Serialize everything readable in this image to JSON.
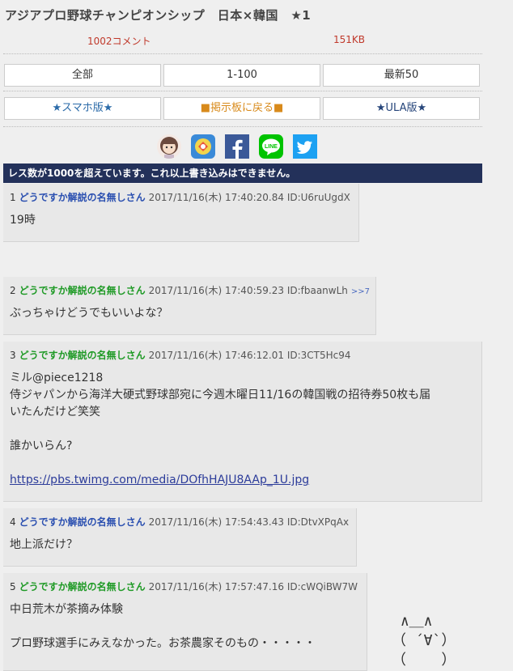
{
  "thread": {
    "title": "アジアプロ野球チャンピオンシップ　日本×韓国　★1",
    "comments": "1002コメント",
    "size": "151KB"
  },
  "nav": {
    "all": "全部",
    "range": "1-100",
    "latest": "最新50",
    "mobile": "★スマホ版★",
    "board": "■掲示板に戻る■",
    "ula": "★ULA版★"
  },
  "notice": "レス数が1000を超えています。これ以上書き込みはできません。",
  "posts": [
    {
      "num": "1",
      "name": "どうですか解説の名無しさん",
      "date": "2017/11/16(木) 17:40:20.84",
      "id": "ID:U6ruUgdX",
      "ref": "",
      "body": [
        "19時"
      ]
    },
    {
      "num": "2",
      "name": "どうですか解説の名無しさん",
      "date": "2017/11/16(木) 17:40:59.23",
      "id": "ID:fbaanwLh",
      "ref": ">>7",
      "body": [
        "ぶっちゃけどうでもいいよな？"
      ]
    },
    {
      "num": "3",
      "name": "どうですか解説の名無しさん",
      "date": "2017/11/16(木) 17:46:12.01",
      "id": "ID:3CT5Hc94",
      "ref": "",
      "body": [
        "ミル@piece1218",
        "侍ジャパンから海洋大硬式野球部宛に今週木曜日11/16の韓国戦の招待券50枚も届",
        "いたんだけど笑笑",
        "",
        "誰かいらん?",
        ""
      ],
      "link": "https://pbs.twimg.com/media/DOfhHAJU8AAp_1U.jpg"
    },
    {
      "num": "4",
      "name": "どうですか解説の名無しさん",
      "date": "2017/11/16(木) 17:54:43.43",
      "id": "ID:DtvXPqAx",
      "ref": "",
      "body": [
        "地上派だけ？"
      ]
    },
    {
      "num": "5",
      "name": "どうですか解説の名無しさん",
      "date": "2017/11/16(木) 17:57:47.16",
      "id": "ID:cWQiBW7W",
      "ref": "",
      "body": [
        "中日荒木が茶摘み体験",
        "",
        "プロ野球選手にみえなかった。お茶農家そのもの・・・・・"
      ]
    }
  ],
  "aa": " ∧＿∧\n（ ´∀`）\n（    ）"
}
